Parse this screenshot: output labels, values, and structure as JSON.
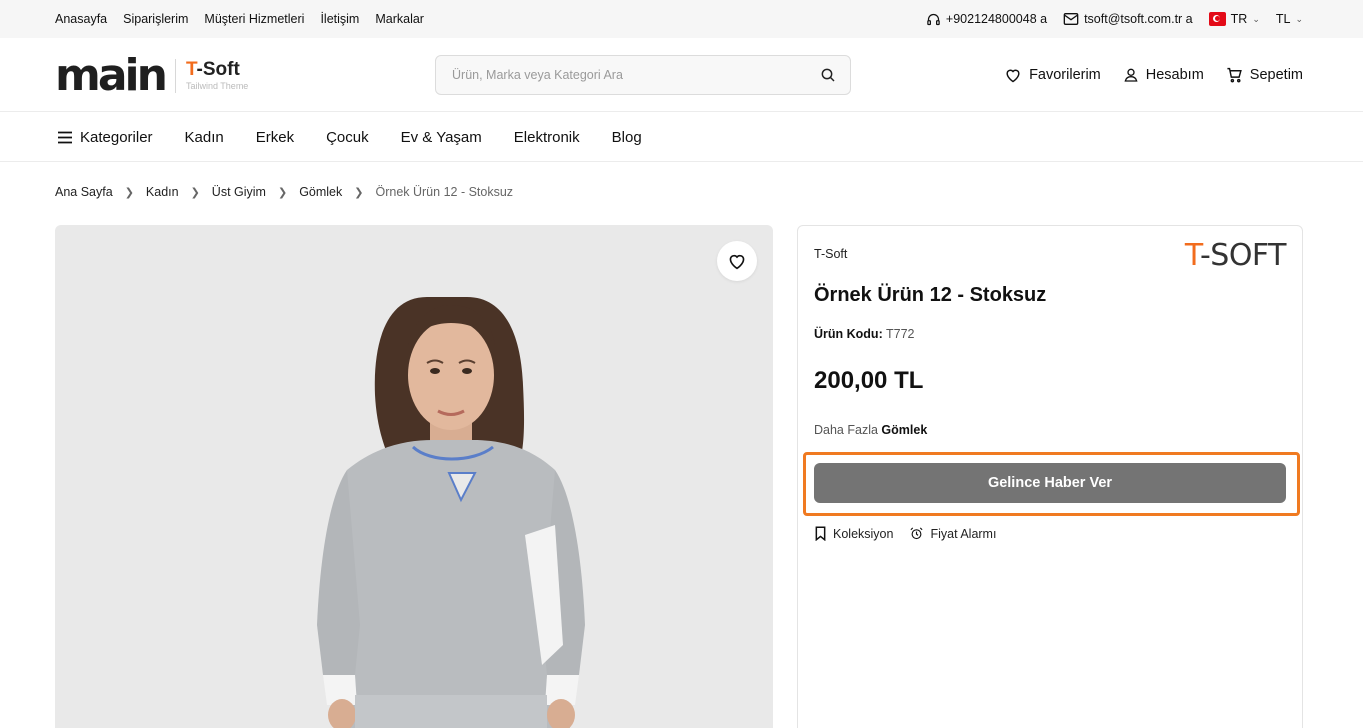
{
  "topbar": {
    "links": [
      "Anasayfa",
      "Siparişlerim",
      "Müşteri Hizmetleri",
      "İletişim",
      "Markalar"
    ],
    "phone": "+902124800048 a",
    "email": "tsoft@tsoft.com.tr a",
    "language": "TR",
    "currency": "TL"
  },
  "header": {
    "logo_main": "main",
    "logo_brand_prefix": "T",
    "logo_brand_rest": "-Soft",
    "logo_tagline": "Tailwind Theme",
    "search_placeholder": "Ürün, Marka veya Kategori Ara",
    "favorites_label": "Favorilerim",
    "account_label": "Hesabım",
    "cart_label": "Sepetim"
  },
  "nav": {
    "categories_label": "Kategoriler",
    "items": [
      "Kadın",
      "Erkek",
      "Çocuk",
      "Ev & Yaşam",
      "Elektronik",
      "Blog"
    ]
  },
  "breadcrumb": [
    "Ana Sayfa",
    "Kadın",
    "Üst Giyim",
    "Gömlek",
    "Örnek Ürün 12 - Stoksuz"
  ],
  "product": {
    "brand": "T-Soft",
    "brand_logo_prefix": "T",
    "brand_logo_rest": "-SOFT",
    "title": "Örnek Ürün 12 - Stoksuz",
    "code_label": "Ürün Kodu:",
    "code_value": "T772",
    "price": "200,00 TL",
    "more_prefix": "Daha Fazla",
    "more_category": "Gömlek",
    "notify_label": "Gelince Haber Ver",
    "collection_label": "Koleksiyon",
    "price_alarm_label": "Fiyat Alarmı"
  },
  "colors": {
    "accent": "#f26c1d",
    "highlight_border": "#f07a21",
    "notify_button": "#747474",
    "topbar_bg": "#f6f6f6",
    "gallery_bg": "#e9e9e9"
  }
}
